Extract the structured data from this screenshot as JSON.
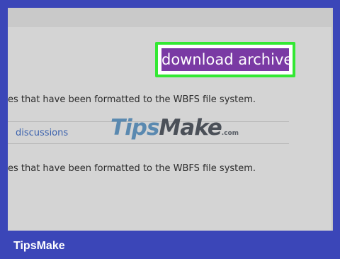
{
  "toolbar": {
    "download_label": "download archive"
  },
  "content": {
    "description_1": "es that have been formatted to the WBFS file system.",
    "description_2": "es that have been formatted to the WBFS file system.",
    "tab_discussions": "discussions"
  },
  "watermark": {
    "part_1": "Tips",
    "part_2": "Make",
    "suffix": ".com"
  },
  "footer": {
    "brand": "TipsMake"
  },
  "colors": {
    "background_border": "#3b46b8",
    "highlight": "#33e833",
    "button": "#7a3aa4",
    "link": "#3a61ad"
  }
}
